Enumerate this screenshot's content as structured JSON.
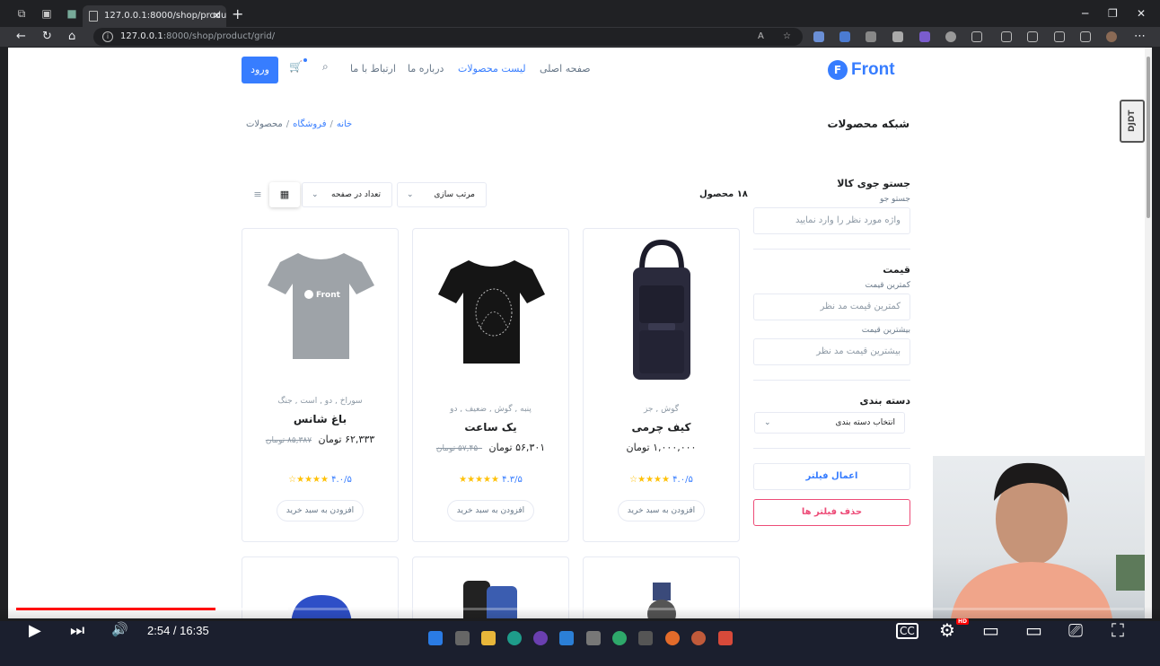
{
  "browser": {
    "tab_title": "127.0.0.1:8000/shop/product/gri",
    "url_host": "127.0.0.1",
    "url_path": ":8000/shop/product/grid/",
    "new_tab": "+",
    "win_min": "─",
    "win_max": "❐",
    "win_close": "✕",
    "tab_close": "✕",
    "back": "←",
    "reload": "↻",
    "home": "⌂",
    "info": "i",
    "read_aloud": "A",
    "favorite": "☆",
    "more": "⋯"
  },
  "header": {
    "logo_letter": "F",
    "logo_text": "Front",
    "menu": [
      "صفحه اصلی",
      "لیست محصولات",
      "درباره ما",
      "ارتباط با ما"
    ],
    "login": "ورود",
    "cart_icon": "🛒",
    "search_icon": "⌕",
    "accent": "#377dff"
  },
  "page": {
    "title": "شبکه محصولات",
    "breadcrumb": [
      "خانه",
      "فروشگاه",
      "محصولات"
    ],
    "breadcrumb_sep": "/"
  },
  "filters": {
    "search_title": "جستو جوی کالا",
    "search_label": "جستو جو",
    "search_placeholder": "واژه مورد نظر را وارد نمایید",
    "price_title": "قیمت",
    "min_label": "کمترین قیمت",
    "min_placeholder": "کمترین قیمت مد نظر",
    "max_label": "بیشترین قیمت",
    "max_placeholder": "بیشترین قیمت مد نظر",
    "category_title": "دسته بندی",
    "category_select": "انتخاب دسته بندی",
    "apply": "اعمال فیلتر",
    "clear": "حذف فیلتر ها"
  },
  "toolbar": {
    "count": "۱۸ محصول",
    "sort": "مرتب سازی",
    "per_page": "تعداد در صفحه",
    "chevron": "⌄",
    "grid_icon": "▦",
    "list_icon": "≡"
  },
  "products": [
    {
      "cats": "گوش , جز",
      "name": "کیف چرمی",
      "price": "۱,۰۰۰,۰۰۰ تومان",
      "old": "",
      "stars": "★★★★☆",
      "rating": "۴.۰/۵",
      "add": "افزودن به سبد خرید",
      "image": "bag"
    },
    {
      "cats": "پنبه , گوش , ضعیف , دو",
      "name": "یک ساعت",
      "price": "۵۶,۳۰۱ تومان",
      "old": "۵۷,۴۵۰ تومان",
      "stars": "★★★★★",
      "rating": "۴.۳/۵",
      "add": "افزودن به سبد خرید",
      "image": "black-tshirt"
    },
    {
      "cats": "سوراخ , دو , است , جنگ",
      "name": "باغ شانس",
      "price": "۶۲,۳۳۳ تومان",
      "old": "۸۵,۳۸۷ تومان",
      "stars": "★★★★☆",
      "rating": "۴.۰/۵",
      "add": "افزودن به سبد خرید",
      "image": "grey-tshirt"
    }
  ],
  "tshirt_print": "Front",
  "watermark": "DJDT",
  "player": {
    "time": "2:54 / 16:35",
    "played_fraction": 0.177,
    "buffered_fraction": 0.241,
    "play": "▶",
    "next": "⏭",
    "volume": "🔊",
    "cc": "CC",
    "settings": "⚙",
    "hd": "HD",
    "miniplayer": "▭",
    "theater": "▭",
    "cast": "⎚",
    "fullscreen": "⛶"
  }
}
